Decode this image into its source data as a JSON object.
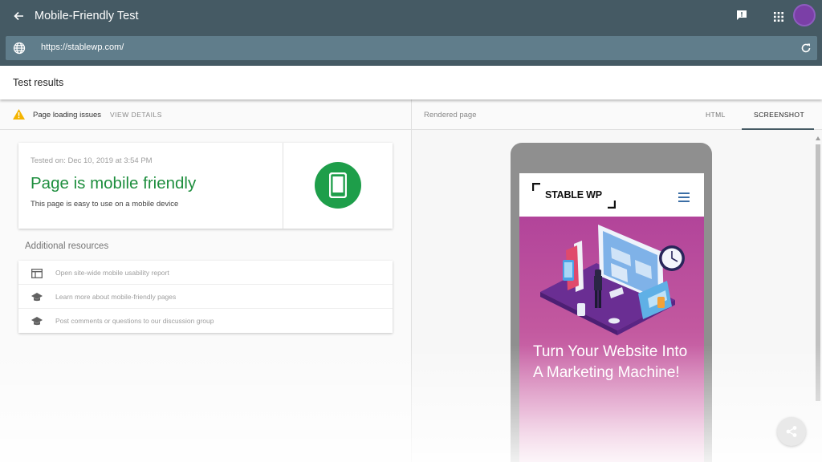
{
  "header": {
    "title": "Mobile-Friendly Test",
    "url": "https://stablewp.com/"
  },
  "results": {
    "title": "Test results"
  },
  "issues": {
    "text": "Page loading issues",
    "details": "VIEW DETAILS"
  },
  "summary": {
    "tested_on": "Tested on: Dec 10, 2019 at 3:54 PM",
    "headline": "Page is mobile friendly",
    "subtitle": "This page is easy to use on a mobile device"
  },
  "resources": {
    "title": "Additional resources",
    "items": [
      {
        "label": "Open site-wide mobile usability report",
        "icon": "report-icon"
      },
      {
        "label": "Learn more about mobile-friendly pages",
        "icon": "school-icon"
      },
      {
        "label": "Post comments or questions to our discussion group",
        "icon": "school-icon"
      }
    ]
  },
  "rendered": {
    "label": "Rendered page",
    "tabs": [
      {
        "label": "HTML",
        "active": false
      },
      {
        "label": "SCREENSHOT",
        "active": true
      }
    ],
    "site_logo": "STABLE WP",
    "hero_heading": "Turn Your Website Into A Marketing Machine!"
  },
  "colors": {
    "header_bg": "#455a64",
    "urlbar_bg": "#607d8b",
    "success_green": "#1e8e3e",
    "warning_amber": "#f4b400",
    "hero_magenta": "#b2449a"
  }
}
